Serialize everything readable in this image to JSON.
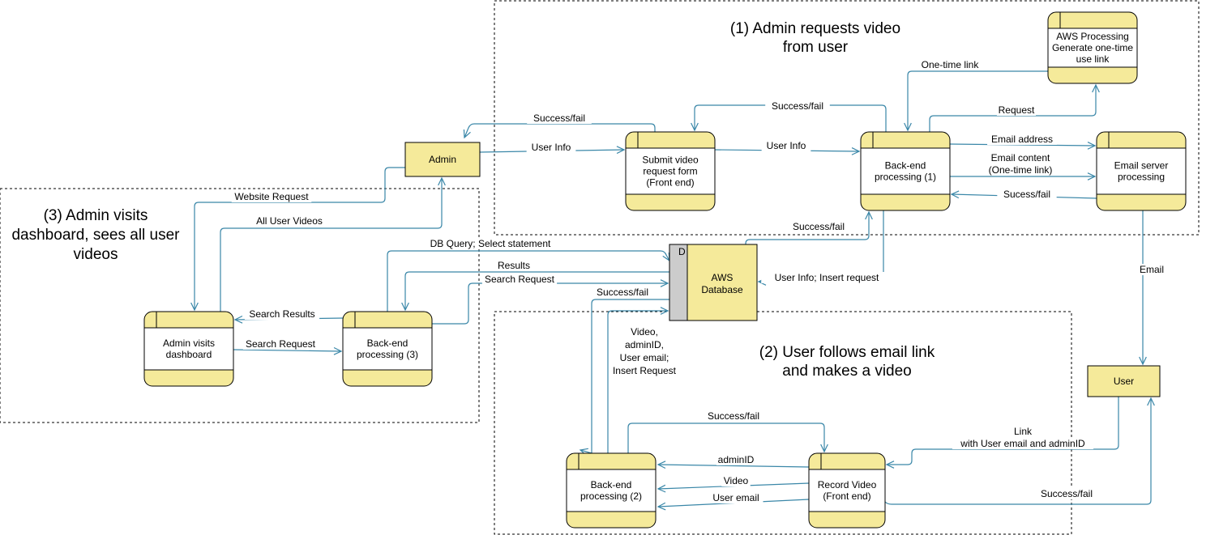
{
  "colors": {
    "node_fill": "#F5EA9A",
    "store_side": "#CCCCCC",
    "edge": "#3A87A8",
    "boundary": "#000000"
  },
  "groups": [
    {
      "id": "g1",
      "title": [
        "(1) Admin requests video",
        "from user"
      ]
    },
    {
      "id": "g2",
      "title": [
        "(2) User follows email link",
        "and makes a video"
      ]
    },
    {
      "id": "g3",
      "title": [
        "(3) Admin visits",
        "dashboard, sees all user",
        "videos"
      ]
    }
  ],
  "entities": [
    {
      "id": "admin",
      "label": "Admin"
    },
    {
      "id": "user",
      "label": "User"
    }
  ],
  "processes": [
    {
      "id": "submit",
      "lines": [
        "Submit video",
        "request form",
        "(Front end)"
      ]
    },
    {
      "id": "be1",
      "lines": [
        "Back-end",
        "processing (1)"
      ]
    },
    {
      "id": "email",
      "lines": [
        "Email server",
        "processing"
      ]
    },
    {
      "id": "aws",
      "lines": [
        "AWS Processing",
        "Generate one-time",
        "use link"
      ]
    },
    {
      "id": "dash",
      "lines": [
        "Admin visits",
        "dashboard"
      ]
    },
    {
      "id": "be3",
      "lines": [
        "Back-end",
        "processing (3)"
      ]
    },
    {
      "id": "be2",
      "lines": [
        "Back-end",
        "processing (2)"
      ]
    },
    {
      "id": "record",
      "lines": [
        "Record Video",
        "(Front end)"
      ]
    }
  ],
  "datastore": {
    "id": "db",
    "tag": "D",
    "lines": [
      "AWS",
      "Database"
    ]
  },
  "flows": [
    {
      "from": "admin",
      "to": "submit",
      "label": [
        "User Info"
      ]
    },
    {
      "from": "submit",
      "to": "admin",
      "label": [
        "Success/fail"
      ]
    },
    {
      "from": "submit",
      "to": "be1",
      "label": [
        "User Info"
      ]
    },
    {
      "from": "be1",
      "to": "submit",
      "label": [
        "Success/fail"
      ]
    },
    {
      "from": "aws",
      "to": "be1",
      "label": [
        "One-time link"
      ]
    },
    {
      "from": "be1",
      "to": "aws",
      "label": [
        "Request"
      ]
    },
    {
      "from": "be1",
      "to": "email",
      "label": [
        "Email address"
      ]
    },
    {
      "from": "be1",
      "to": "email",
      "label": [
        "Email content",
        "(One-time link)"
      ]
    },
    {
      "from": "email",
      "to": "be1",
      "label": [
        "Sucess/fail"
      ]
    },
    {
      "from": "email",
      "to": "user",
      "label": [
        "Email"
      ]
    },
    {
      "from": "db",
      "to": "be1",
      "label": [
        "Success/fail"
      ]
    },
    {
      "from": "be1",
      "to": "db",
      "label": [
        "User Info; Insert request"
      ]
    },
    {
      "from": "be3",
      "to": "db",
      "label": [
        "DB Query; Select statement"
      ]
    },
    {
      "from": "db",
      "to": "be3",
      "label": [
        "Results"
      ]
    },
    {
      "from": "be3",
      "to": "db",
      "label": [
        "Search Request"
      ]
    },
    {
      "from": "db",
      "to": "be2",
      "label": [
        "Success/fail"
      ]
    },
    {
      "from": "be2",
      "to": "db",
      "label": [
        "Video,",
        "adminID,",
        "User email;",
        "Insert Request"
      ]
    },
    {
      "from": "be2",
      "to": "record",
      "label": [
        "Success/fail"
      ]
    },
    {
      "from": "record",
      "to": "be2",
      "label": [
        "adminID"
      ]
    },
    {
      "from": "record",
      "to": "be2",
      "label": [
        "Video"
      ]
    },
    {
      "from": "record",
      "to": "be2",
      "label": [
        "User email"
      ]
    },
    {
      "from": "user",
      "to": "record",
      "label": [
        "Link",
        "with User email and adminID"
      ]
    },
    {
      "from": "record",
      "to": "user",
      "label": [
        "Success/fail"
      ]
    },
    {
      "from": "admin",
      "to": "dash",
      "label": [
        "Website Request"
      ]
    },
    {
      "from": "dash",
      "to": "admin",
      "label": [
        "All User Videos"
      ]
    },
    {
      "from": "be3",
      "to": "dash",
      "label": [
        "Search Results"
      ]
    },
    {
      "from": "dash",
      "to": "be3",
      "label": [
        "Search Request"
      ]
    }
  ]
}
